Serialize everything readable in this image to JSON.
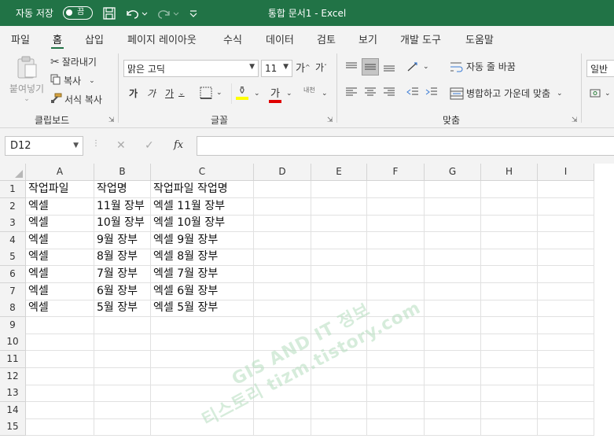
{
  "titlebar": {
    "autosave_label": "자동 저장",
    "autosave_state": "끔",
    "title": "통합 문서1  -  Excel"
  },
  "tabs": [
    "파일",
    "홈",
    "삽입",
    "페이지 레이아웃",
    "수식",
    "데이터",
    "검토",
    "보기",
    "개발 도구",
    "도움말"
  ],
  "active_tab": "홈",
  "ribbon": {
    "clipboard": {
      "paste": "붙여넣기",
      "cut": "잘라내기",
      "copy": "복사",
      "format_painter": "서식 복사",
      "label": "클립보드"
    },
    "font": {
      "font_name": "맑은 고딕",
      "font_size": "11",
      "grow": "가",
      "shrink": "가",
      "bold": "가",
      "italic": "가",
      "underline": "가",
      "font_color_glyph": "가",
      "phonetic": "내천",
      "label": "글꼴"
    },
    "alignment": {
      "wrap": "자동 줄 바꿈",
      "merge": "병합하고 가운데 맞춤",
      "label": "맞춤"
    },
    "number": {
      "format": "일반"
    }
  },
  "formula_bar": {
    "name_box": "D12",
    "fx": "fx",
    "value": ""
  },
  "columns": [
    "A",
    "B",
    "C",
    "D",
    "E",
    "F",
    "G",
    "H",
    "I"
  ],
  "rows": [
    "1",
    "2",
    "3",
    "4",
    "5",
    "6",
    "7",
    "8",
    "9",
    "10",
    "11",
    "12",
    "13",
    "14",
    "15"
  ],
  "cells": [
    [
      "작업파일",
      "작업명",
      "작업파일 작업명"
    ],
    [
      "엑셀",
      "11월 장부",
      "엑셀 11월 장부"
    ],
    [
      "엑셀",
      "10월 장부",
      "엑셀 10월 장부"
    ],
    [
      "엑셀",
      "9월 장부",
      "엑셀 9월 장부"
    ],
    [
      "엑셀",
      "8월 장부",
      "엑셀 8월 장부"
    ],
    [
      "엑셀",
      "7월 장부",
      "엑셀 7월 장부"
    ],
    [
      "엑셀",
      "6월 장부",
      "엑셀 6월 장부"
    ],
    [
      "엑셀",
      "5월 장부",
      "엑셀 5월 장부"
    ]
  ],
  "watermark": {
    "line1": "GIS AND IT 정보",
    "line2": "티스토리 tizm.tistory.com"
  },
  "colors": {
    "accent": "#217346",
    "ribbon_bg": "#f3f3f3"
  }
}
